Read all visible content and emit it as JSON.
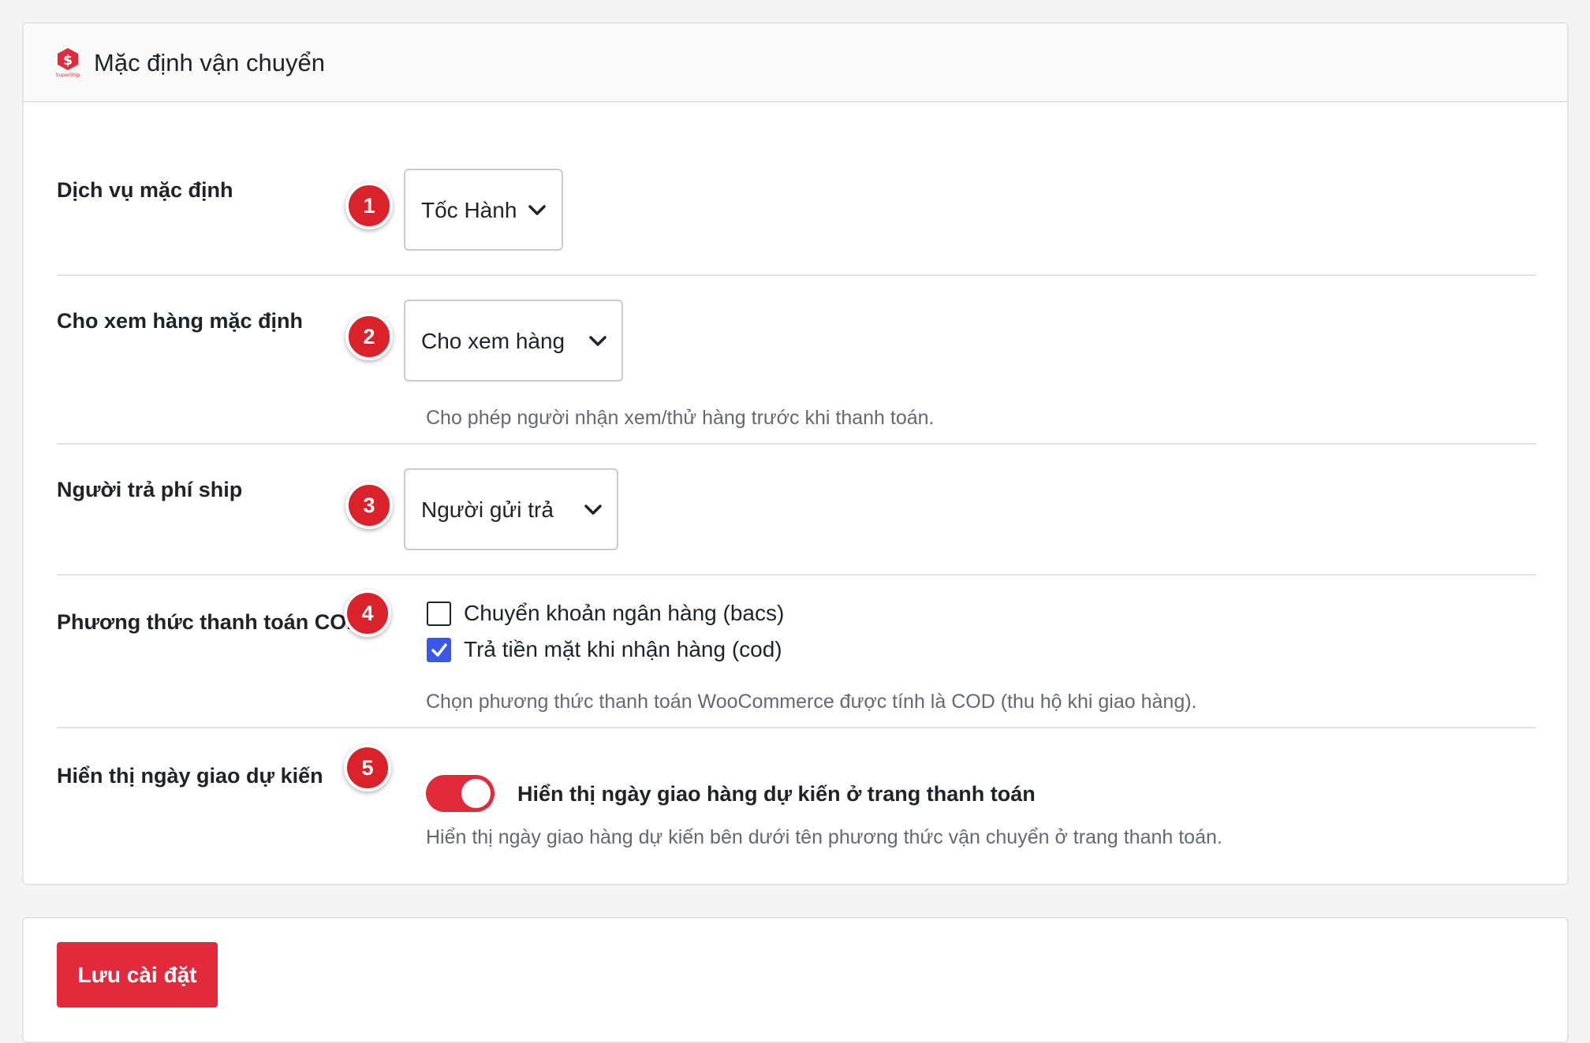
{
  "header": {
    "title": "Mặc định vận chuyển",
    "logo_icon": "superships-logo",
    "logo_text": "SuperShip"
  },
  "colors": {
    "brand_red": "#e12a3c",
    "badge_red": "#d9222a",
    "checkbox_blue": "#3858e9"
  },
  "rows": {
    "service": {
      "badge": "1",
      "label": "Dịch vụ mặc định",
      "selected": "Tốc Hành"
    },
    "inspect": {
      "badge": "2",
      "label": "Cho xem hàng mặc định",
      "selected": "Cho xem hàng",
      "help": "Cho phép người nhận xem/thử hàng trước khi thanh toán."
    },
    "payer": {
      "badge": "3",
      "label": "Người trả phí ship",
      "selected": "Người gửi trả"
    },
    "cod": {
      "badge": "4",
      "label": "Phương thức thanh toán COD",
      "options": [
        {
          "label": "Chuyển khoản ngân hàng (bacs)",
          "checked": false
        },
        {
          "label": "Trả tiền mặt khi nhận hàng (cod)",
          "checked": true
        }
      ],
      "help": "Chọn phương thức thanh toán WooCommerce được tính là COD (thu hộ khi giao hàng)."
    },
    "eta": {
      "badge": "5",
      "label": "Hiển thị ngày giao dự kiến",
      "toggle_on": true,
      "toggle_label": "Hiển thị ngày giao hàng dự kiến ở trang thanh toán",
      "help": "Hiển thị ngày giao hàng dự kiến bên dưới tên phương thức vận chuyển ở trang thanh toán."
    }
  },
  "footer": {
    "save_label": "Lưu cài đặt"
  }
}
